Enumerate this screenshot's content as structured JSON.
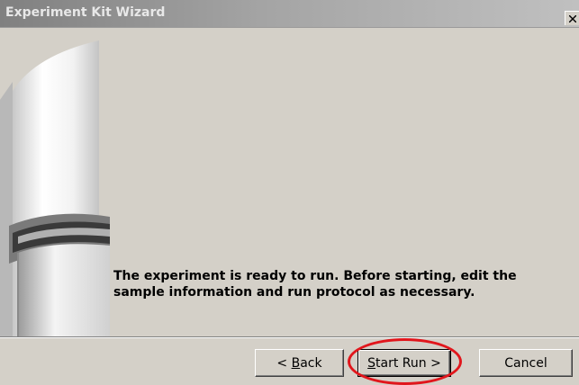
{
  "window": {
    "title": "Experiment Kit Wizard",
    "close_symbol": "×"
  },
  "message": {
    "line1": "The experiment is ready to run. Before starting, edit the",
    "line2": "sample information and run protocol as necessary."
  },
  "buttons": {
    "back": {
      "prefix": "< ",
      "mnemonic": "B",
      "rest": "ack"
    },
    "start_run": {
      "mnemonic": "S",
      "rest": "tart Run >"
    },
    "cancel": "Cancel"
  },
  "colors": {
    "dialog_bg": "#d4d0c8",
    "annotation_ring": "#e1161c"
  },
  "icons": [
    "close-icon",
    "wizard-tube-illustration"
  ]
}
